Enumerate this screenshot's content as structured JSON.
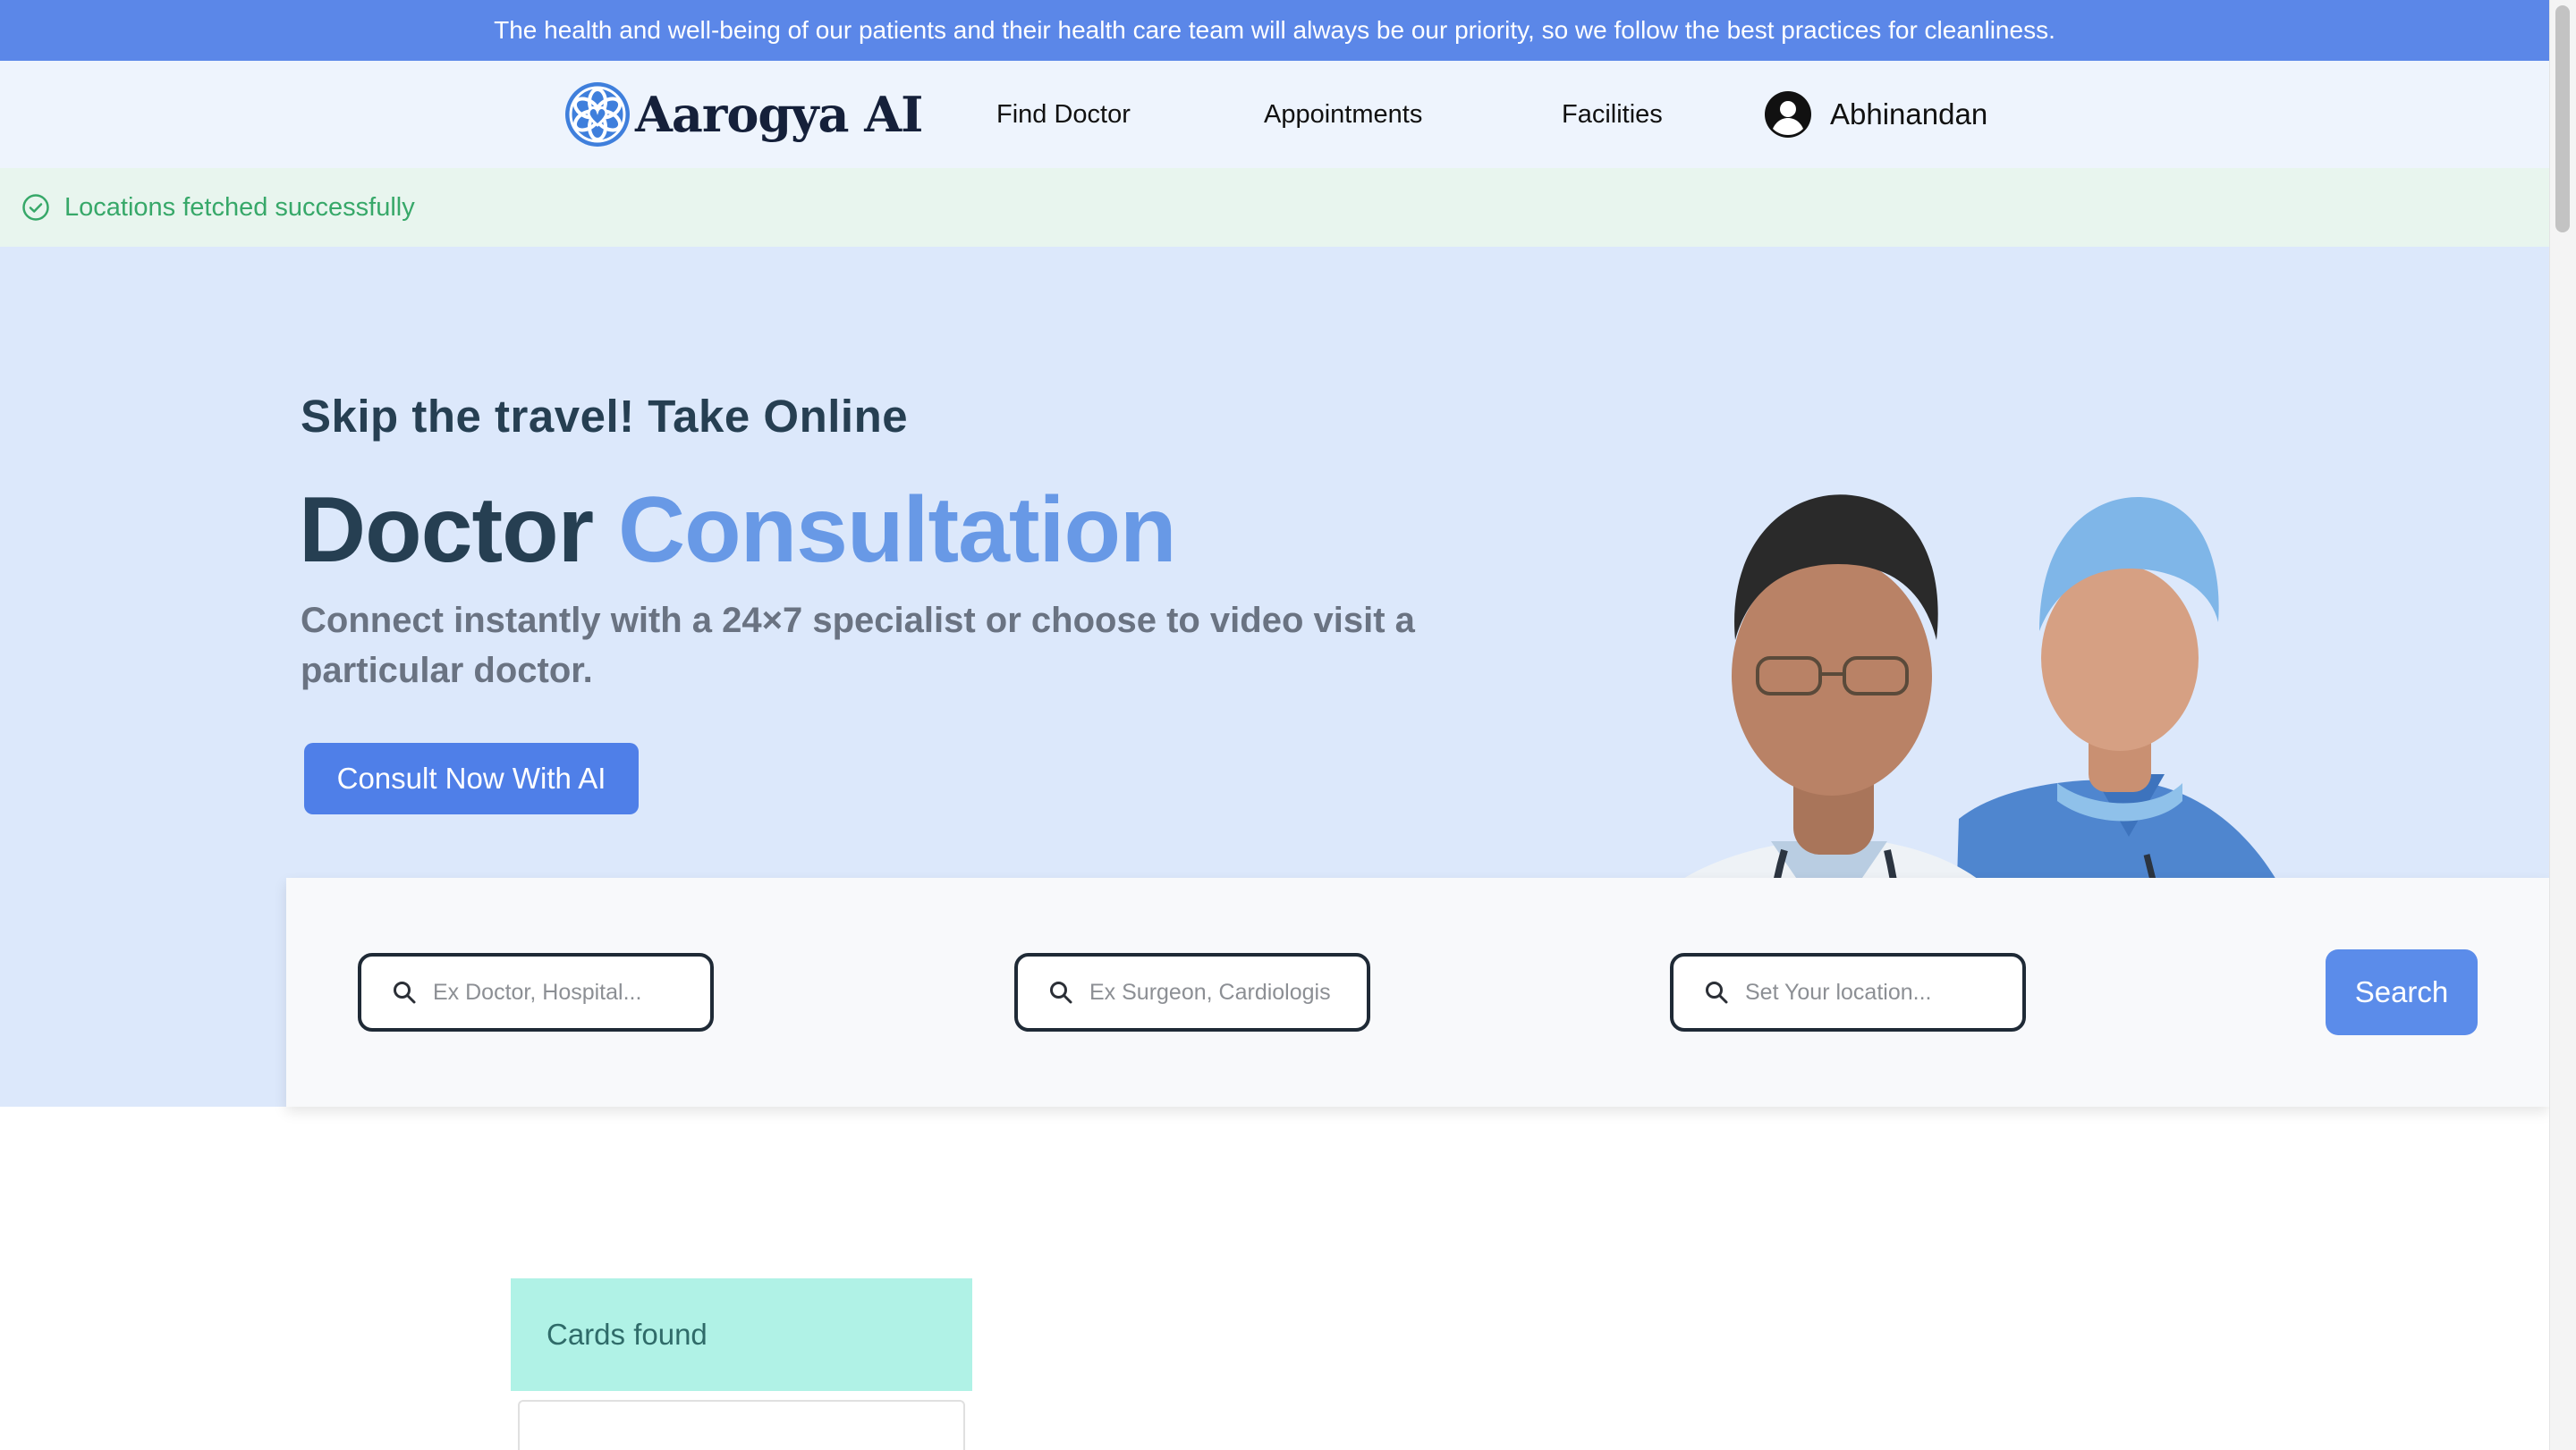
{
  "banner": {
    "text": "The health and well-being of our patients and their health care team will always be our priority, so we follow the best practices for cleanliness."
  },
  "nav": {
    "brand": "Aarogya AI",
    "links": [
      "Find Doctor",
      "Appointments",
      "Facilities"
    ],
    "user_name": "Abhinandan"
  },
  "toast": {
    "message": "Locations fetched successfully",
    "icon": "check-circle-icon"
  },
  "hero": {
    "subtitle": "Skip the travel! Take Online",
    "title_main": "Doctor",
    "title_accent": "Consultation",
    "description": "Connect instantly with a 24×7 specialist or choose to video visit a particular doctor.",
    "cta_label": "Consult Now With AI"
  },
  "search": {
    "fields": [
      {
        "placeholder": "Ex Doctor, Hospital..."
      },
      {
        "placeholder": "Ex Surgeon, Cardiologis"
      },
      {
        "placeholder": "Set Your location..."
      }
    ],
    "button_label": "Search"
  },
  "results": {
    "heading": "Cards found"
  },
  "colors": {
    "banner": "#5b87e8",
    "nav_bg": "#eef4fd",
    "toast_bg": "#e8f5ee",
    "toast_text": "#37a869",
    "hero_bg": "#dce8fb",
    "heading": "#263f52",
    "accent": "#6899e6",
    "primary_button": "#4f7fe8",
    "cards_found_bg": "#b0f2e6"
  }
}
